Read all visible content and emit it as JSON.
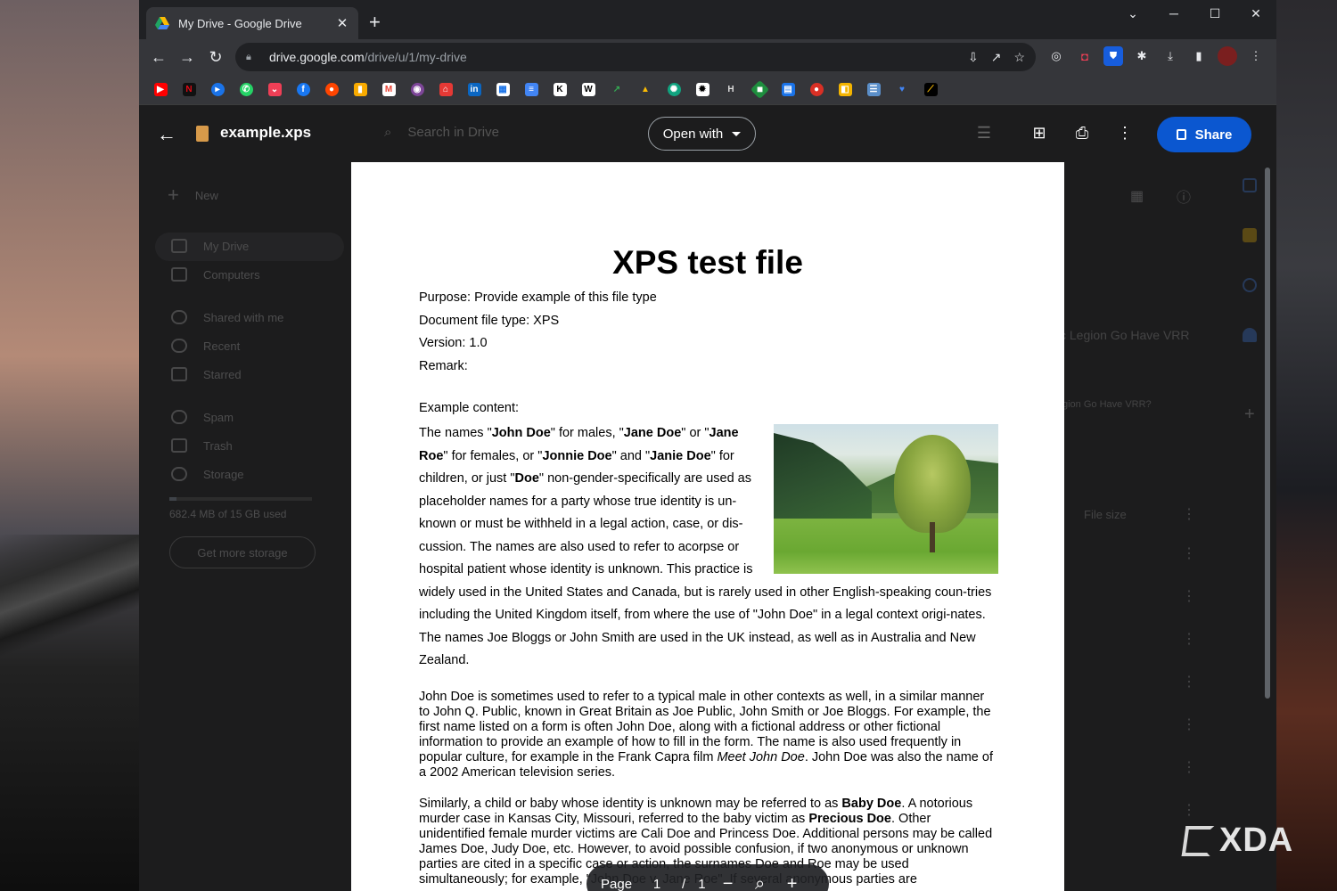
{
  "browser": {
    "tab_title": "My Drive - Google Drive",
    "url_host": "drive.google.com",
    "url_path": "/drive/u/1/my-drive"
  },
  "drive_background": {
    "new_label": "New",
    "nav": [
      "My Drive",
      "Computers",
      "Shared with me",
      "Recent",
      "Starred",
      "Spam",
      "Trash",
      "Storage"
    ],
    "storage_text": "682.4 MB of 15 GB used",
    "get_more_storage": "Get more storage",
    "search_placeholder": "Search in Drive",
    "right_title": "c Legion Go Have VRR",
    "right_subtitle": "gion Go Have VRR?",
    "file_size_header": "File size"
  },
  "viewer": {
    "file_name": "example.xps",
    "open_with": "Open with",
    "share": "Share"
  },
  "document": {
    "title": "XPS test file",
    "meta_lines": [
      "Purpose: Provide example of this file type",
      "Document file type: XPS",
      "Version: 1.0",
      "Remark:"
    ],
    "example_label": "Example content:",
    "para1": {
      "s1": "The names \"",
      "b1": "John Doe",
      "s2": "\" for males, \"",
      "b2": "Jane Doe",
      "s3": "\" or \"",
      "b3": "Jane Roe",
      "s4": "\" for females, or \"",
      "b4": "Jonnie Doe",
      "s5": "\" and \"",
      "b5": "Janie Doe",
      "s6": "\" for children, or just \"",
      "b6": "Doe",
      "s7": "\" non-gender-specifically are used as placeholder names for a party whose true identity is un-known or must be withheld in a legal action, case, or dis-cussion. The names are also used to refer to acorpse or hospital patient whose identity is unknown. This practice is widely used in the United States and Canada, but is rarely used in other English-speaking coun-tries including the United Kingdom itself, from where the use of \"John Doe\" in a legal context origi-nates. The names Joe Bloggs or John Smith are used in the UK instead, as well as in Australia and New Zealand."
    },
    "para2": {
      "s1": "John Doe is sometimes used to refer to a typical male in other contexts as well, in a similar manner to John Q. Public, known in Great Britain as Joe Public, John Smith or Joe Bloggs. For example, the first name listed on a form is often John Doe, along with a fictional address or other fictional information to provide an example of how to fill in the form. The name is also used frequently in popular culture, for example in the Frank Capra film ",
      "i1": "Meet John Doe",
      "s2": ". John Doe was also the name of a 2002 American television series."
    },
    "para3": {
      "s1": "Similarly, a child or baby whose identity is unknown may be referred to as ",
      "b1": "Baby Doe",
      "s2": ". A notorious murder case in Kansas City, Missouri, referred to the baby victim as ",
      "b2": "Precious Doe",
      "s3": ". Other unidentified female murder victims are Cali Doe and Princess Doe. Additional persons may be called James Doe, Judy Doe, etc. However, to avoid possible confusion, if two anonymous or unknown parties are cited in a specific case or action, the surnames Doe and Roe may be used simultaneously; for example, \"John Doe v. Jane Roe\". If several anonymous parties are"
    }
  },
  "page_control": {
    "label": "Page",
    "current": "1",
    "sep": "/",
    "total": "1"
  },
  "watermark": "XDA"
}
